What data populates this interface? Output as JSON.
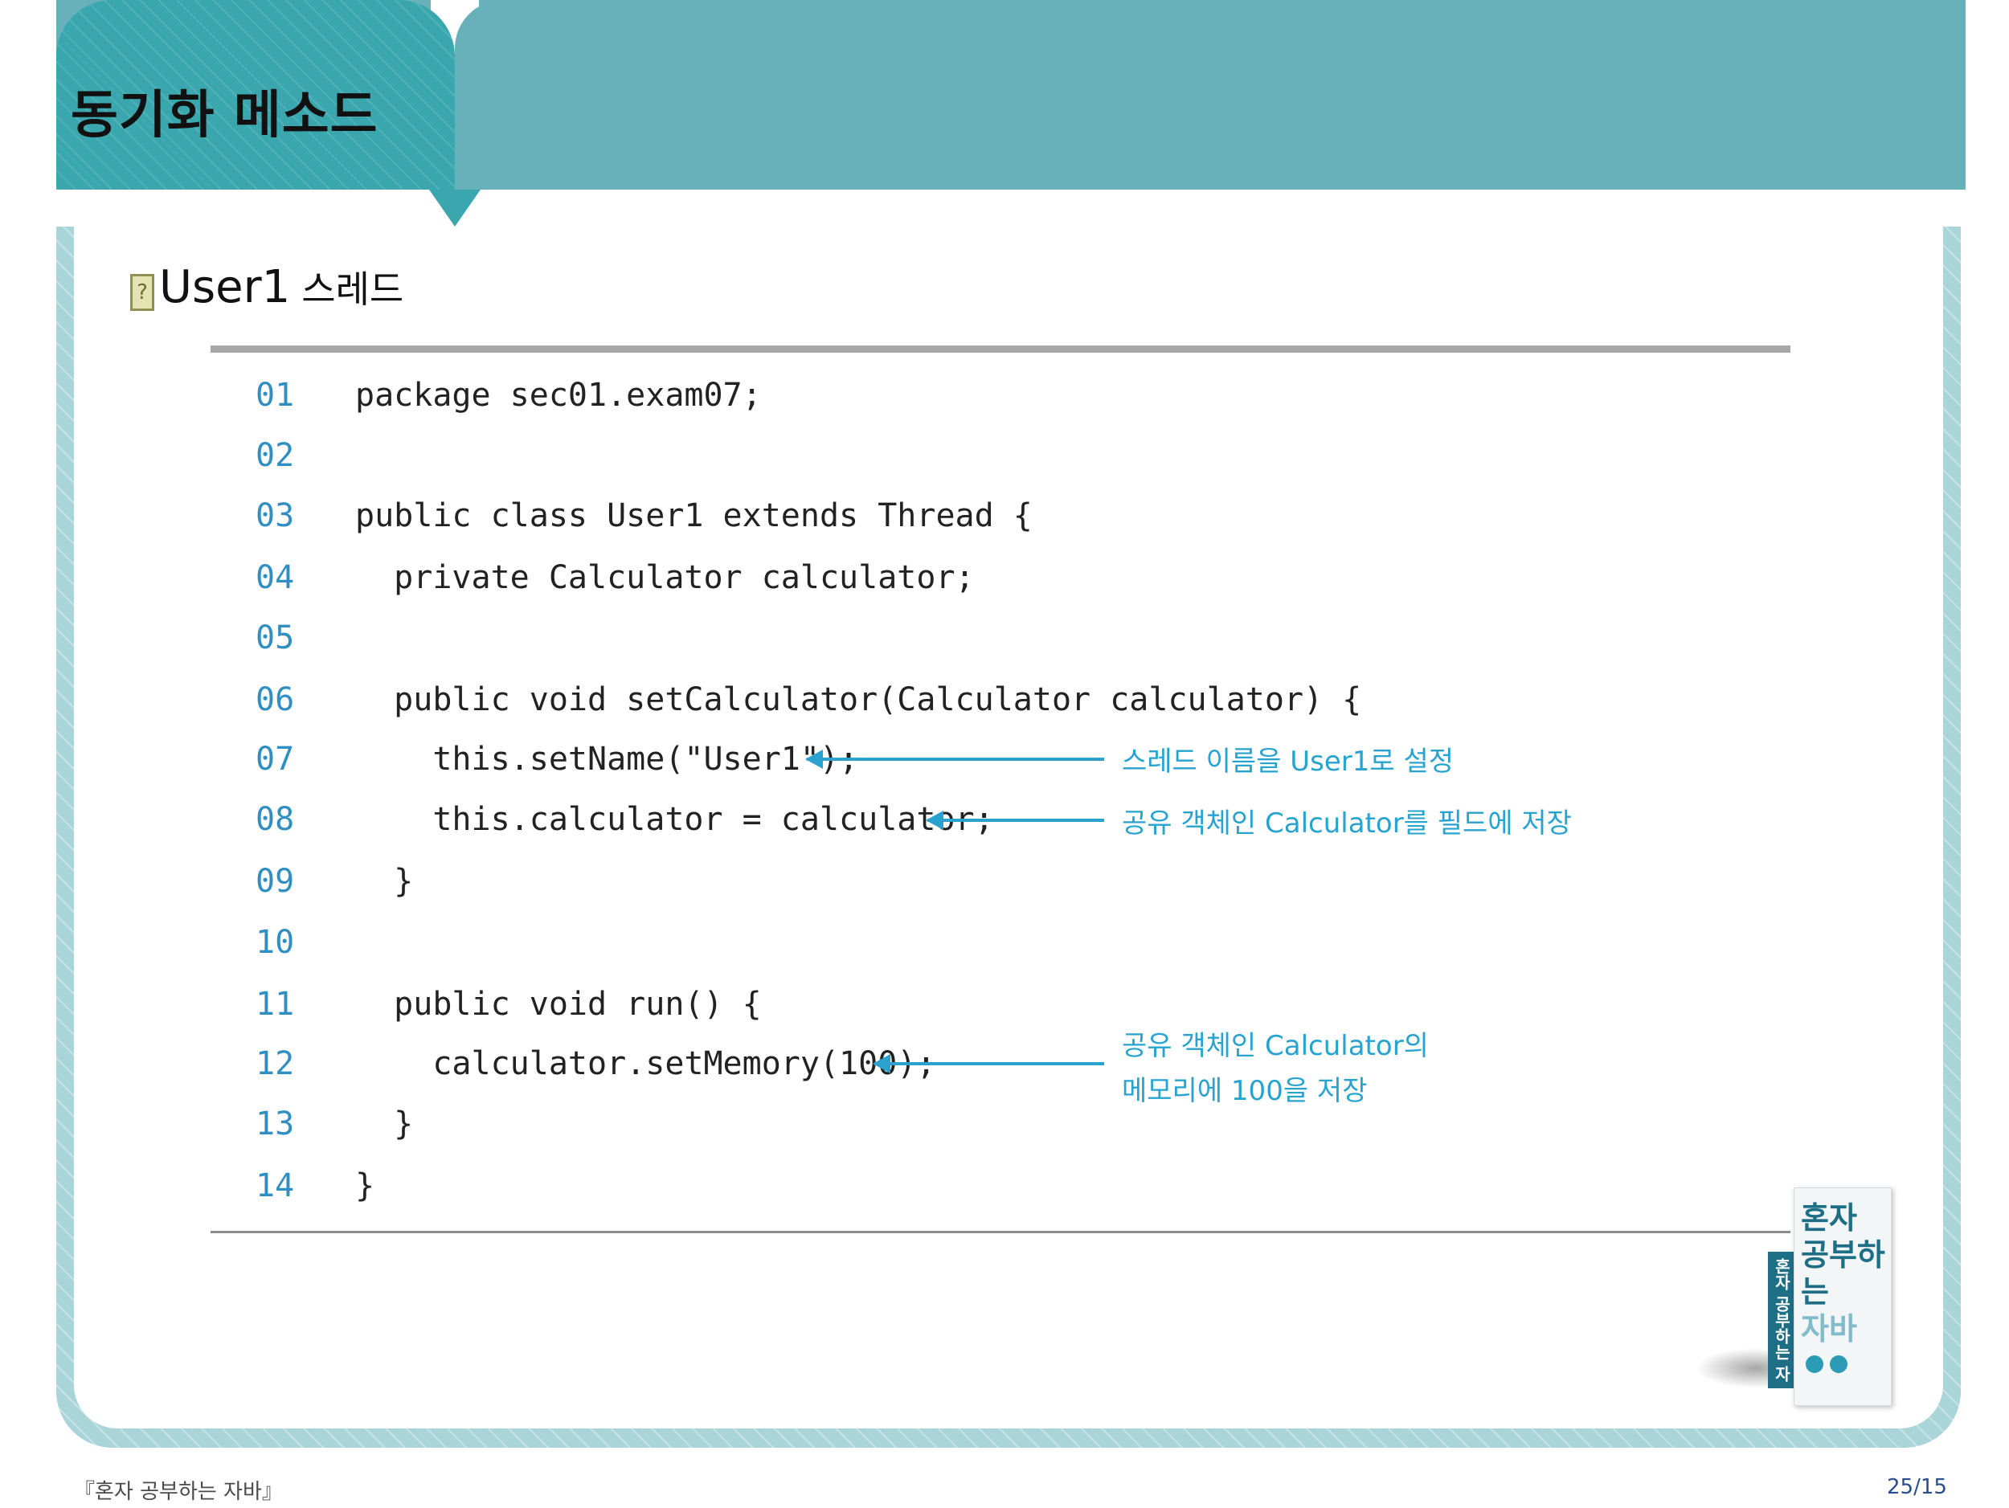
{
  "header": {
    "title": "동기화 메소드"
  },
  "subtitle": {
    "icon": "question-box-icon",
    "icon_glyph": "?",
    "main": "User1",
    "korean": "스레드"
  },
  "code": {
    "lines": [
      {
        "no": "01",
        "text": "package sec01.exam07;"
      },
      {
        "no": "02",
        "text": ""
      },
      {
        "no": "03",
        "text": "public class User1 extends Thread {"
      },
      {
        "no": "04",
        "text": "  private Calculator calculator;"
      },
      {
        "no": "05",
        "text": ""
      },
      {
        "no": "06",
        "text": "  public void setCalculator(Calculator calculator) {"
      },
      {
        "no": "07",
        "text": "    this.setName(\"User1\");"
      },
      {
        "no": "08",
        "text": "    this.calculator = calculator;"
      },
      {
        "no": "09",
        "text": "  }"
      },
      {
        "no": "10",
        "text": ""
      },
      {
        "no": "11",
        "text": "  public void run() {"
      },
      {
        "no": "12",
        "text": "    calculator.setMemory(100);"
      },
      {
        "no": "13",
        "text": "  }"
      },
      {
        "no": "14",
        "text": "}"
      }
    ]
  },
  "annotations": {
    "line07": "스레드 이름을 User1로 설정",
    "line08": "공유 객체인 Calculator를 필드에 저장",
    "line12_a": "공유 객체인 Calculator의",
    "line12_b": "메모리에 100을 저장"
  },
  "book": {
    "title_1": "혼자",
    "title_2": "공부하는",
    "title_3": "자바",
    "spine": "혼자 공부하는 자바"
  },
  "footer": {
    "left": "『혼자 공부하는 자바』",
    "right": "25/15"
  },
  "colors": {
    "header_tab": "#3aa7ae",
    "header_band": "#68b1bb",
    "frame": "#a9d4d8",
    "line_numbers": "#2f8fc2",
    "annotation": "#27a3cf"
  }
}
